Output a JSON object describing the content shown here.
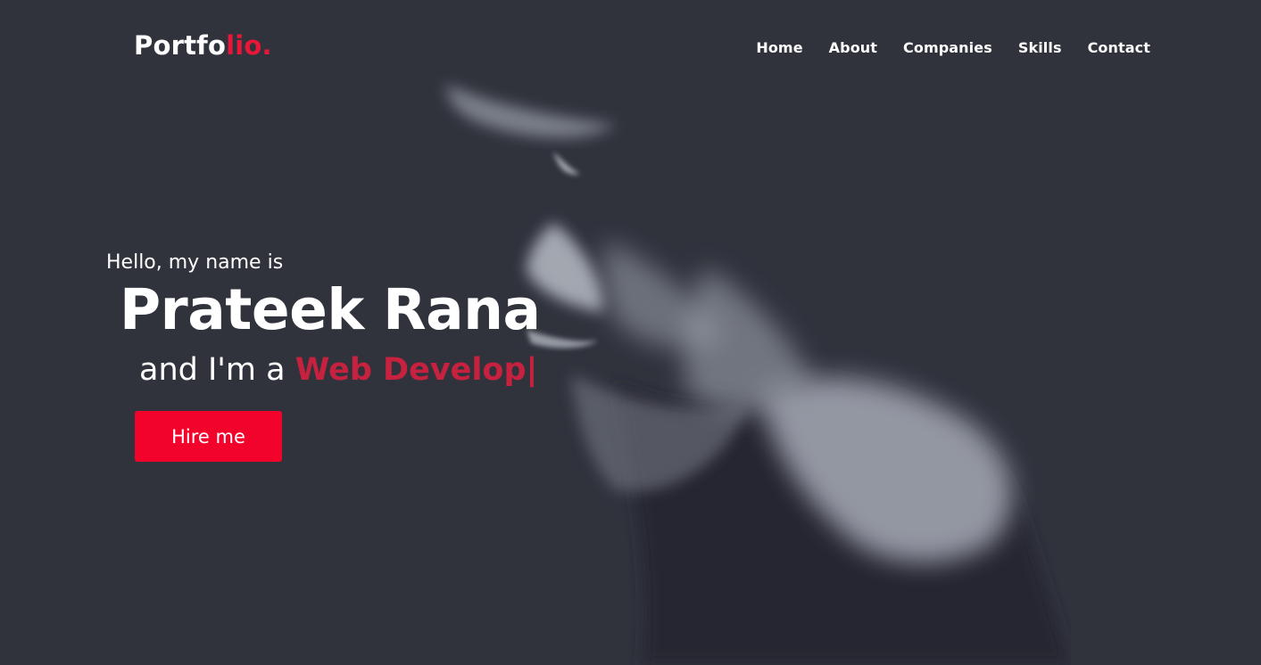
{
  "logo": {
    "part1": "Portfo",
    "part2": "lio."
  },
  "nav": {
    "items": [
      {
        "label": "Home"
      },
      {
        "label": "About"
      },
      {
        "label": "Companies"
      },
      {
        "label": "Skills"
      },
      {
        "label": "Contact"
      }
    ]
  },
  "hero": {
    "greeting": "Hello, my name is",
    "name": "Prateek Rana",
    "role_prefix": "and I'm a ",
    "role_typed": "Web Develop",
    "cursor": "|",
    "cta_label": "Hire me"
  },
  "colors": {
    "background": "#30333c",
    "accent": "#e8173a",
    "typed_text": "#c6213f",
    "button": "#f1032c",
    "text": "#ffffff"
  }
}
